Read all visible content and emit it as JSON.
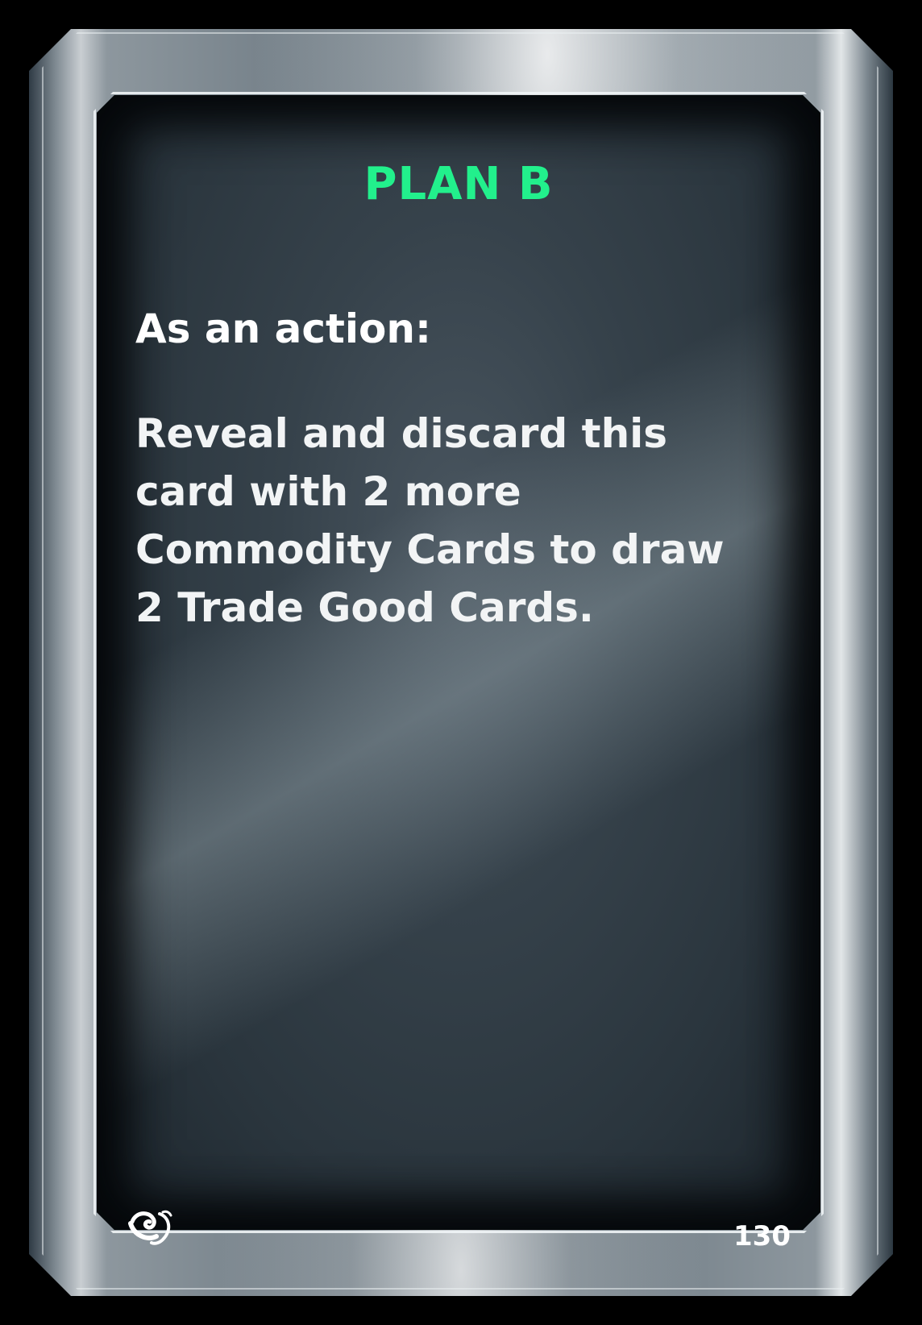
{
  "card": {
    "title": "PLAN B",
    "lead": "As an action:",
    "body": "Reveal and discard this card with 2 more Commodity Cards to draw 2 Trade Good Cards.",
    "number": "130",
    "logo_icon": "swirl-logo-icon"
  },
  "colors": {
    "title": "#22f08c",
    "text": "#ffffff",
    "background": "#000000"
  }
}
